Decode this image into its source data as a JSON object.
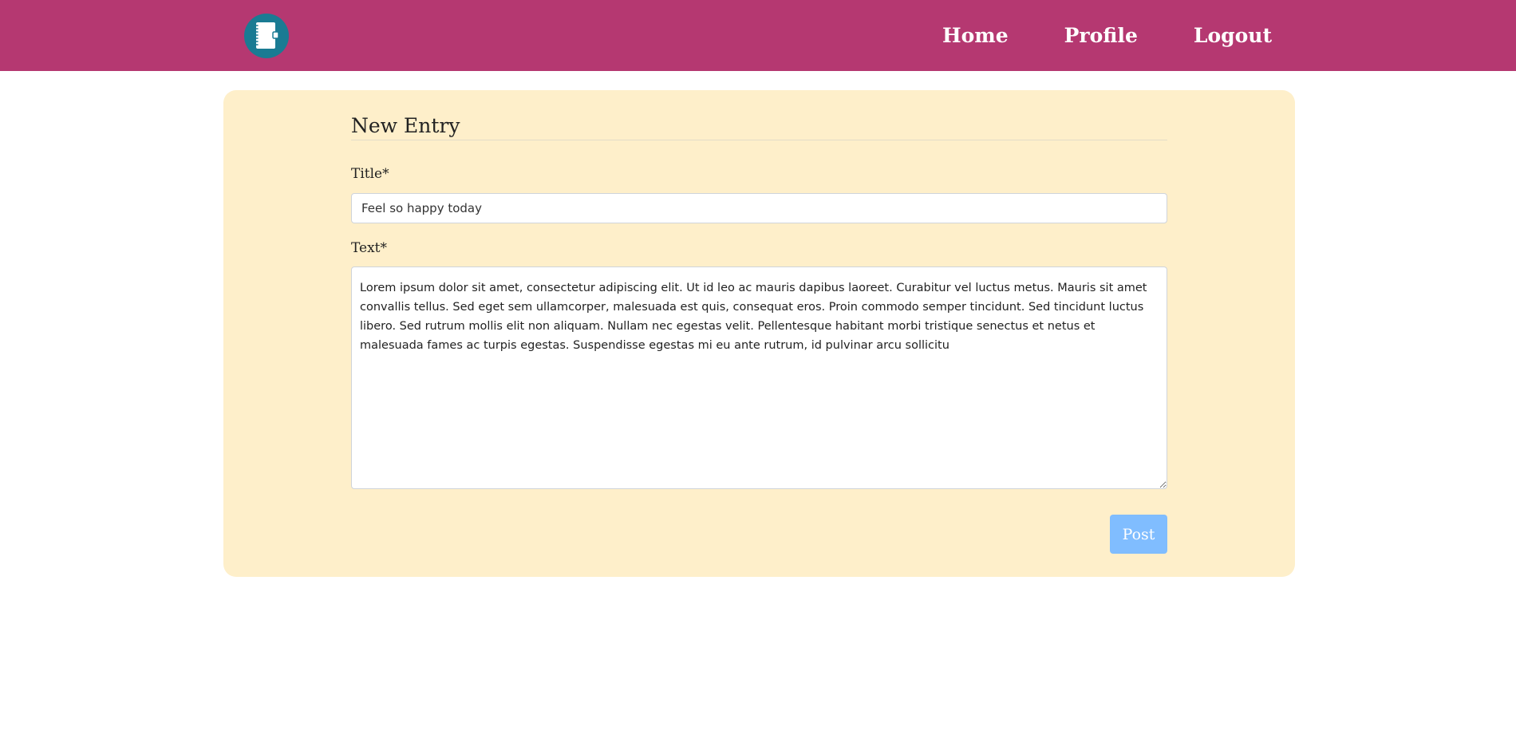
{
  "nav": {
    "logo_icon": "notebook-icon",
    "links": [
      "Home",
      "Profile",
      "Logout"
    ]
  },
  "form": {
    "heading": "New Entry",
    "title_label": "Title*",
    "title_value": "Feel so happy today",
    "text_label": "Text*",
    "text_value": "Lorem ipsum dolor sit amet, consectetur adipiscing elit. Ut id leo ac mauris dapibus laoreet. Curabitur vel luctus metus. Mauris sit amet convallis tellus. Sed eget sem ullamcorper, malesuada est quis, consequat eros. Proin commodo semper tincidunt. Sed tincidunt luctus libero. Sed rutrum mollis elit non aliquam. Nullam nec egestas velit. Pellentesque habitant morbi tristique senectus et netus et malesuada fames ac turpis egestas. Suspendisse egestas mi eu ante rutrum, id pulvinar arcu sollicitu",
    "submit_label": "Post"
  },
  "colors": {
    "navbar": "#b53871",
    "card": "#feefca",
    "logo": "#1a7b93",
    "button": "#80bdff"
  }
}
